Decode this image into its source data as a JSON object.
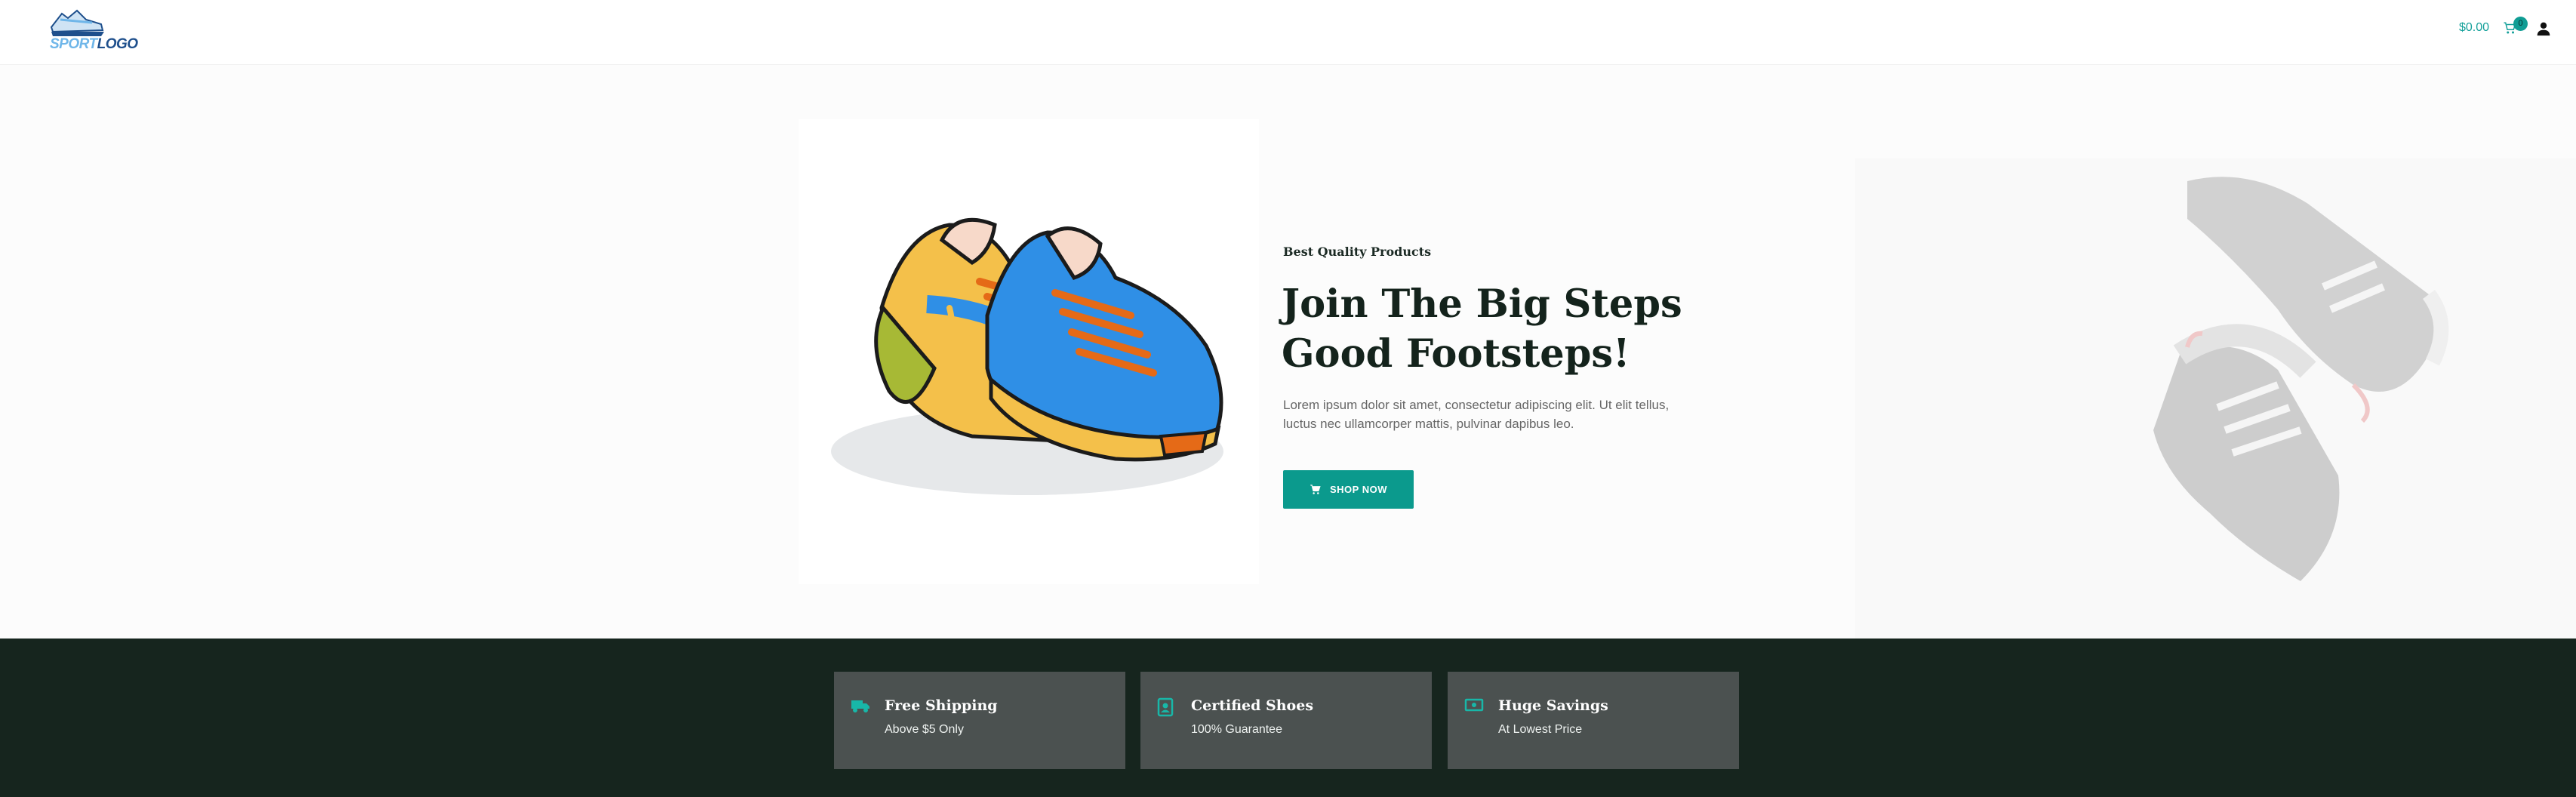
{
  "header": {
    "logo_text_a": "SPORT",
    "logo_text_b": "LOGO",
    "cart_total": "$0.00",
    "cart_count": "0",
    "cart_icon": "cart-icon",
    "user_icon": "user-icon"
  },
  "hero": {
    "eyebrow": "Best Quality Products",
    "title": "Join The Big Steps Good Footsteps!",
    "description": "Lorem ipsum dolor sit amet, consectetur adipiscing elit. Ut elit tellus, luctus nec ullamcorper mattis, pulvinar dapibus leo.",
    "cta_label": "SHOP NOW",
    "cta_icon": "cart-icon"
  },
  "features": [
    {
      "title": "Free Shipping",
      "subtitle": "Above $5 Only",
      "icon": "truck-icon"
    },
    {
      "title": "Certified Shoes",
      "subtitle": "100% Guarantee",
      "icon": "badge-icon"
    },
    {
      "title": "Huge Savings",
      "subtitle": "At Lowest Price",
      "icon": "money-icon"
    }
  ],
  "colors": {
    "accent": "#0b9a8d",
    "dark_band": "#16251e",
    "feature_box": "#4b5150"
  }
}
